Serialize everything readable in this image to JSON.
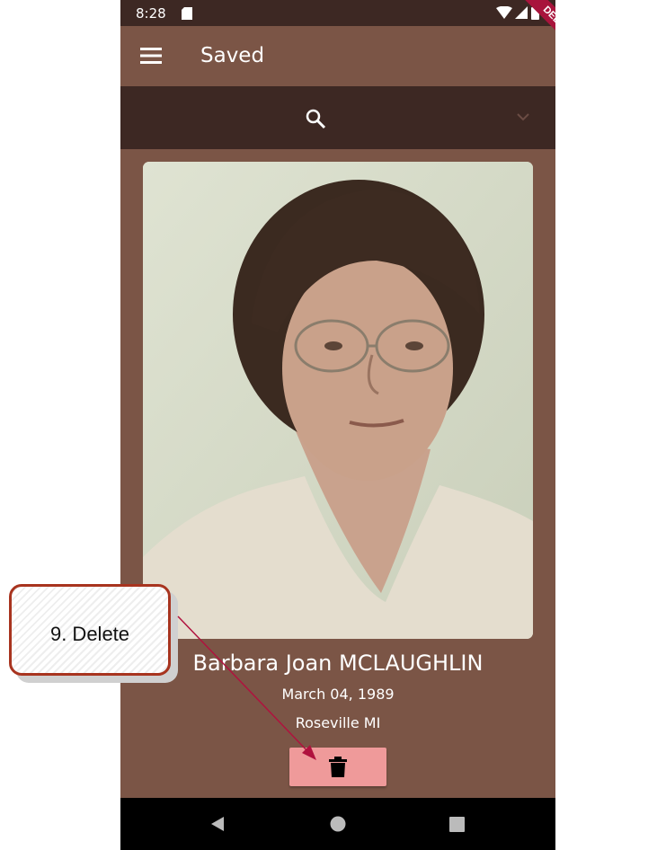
{
  "status_bar": {
    "time": "8:28",
    "icons": [
      "sd-card-icon",
      "wifi-icon",
      "signal-icon",
      "battery-icon"
    ]
  },
  "app_bar": {
    "title": "Saved",
    "menu_icon": "menu-icon",
    "debug_banner": "DEBUG"
  },
  "search_bar": {
    "search_icon": "search-icon",
    "dropdown_icon": "chevron-down-icon"
  },
  "record": {
    "name": "Barbara Joan MCLAUGHLIN",
    "date": "March 04, 1989",
    "location": "Roseville MI",
    "delete_icon": "trash-icon"
  },
  "nav_bar": {
    "icons": [
      "back-icon",
      "home-icon",
      "recents-icon"
    ]
  },
  "callout": {
    "text": "9. Delete"
  },
  "colors": {
    "app_bar": "#7b5546",
    "dark_bar": "#3d2823",
    "delete_button": "#ef9a9a",
    "callout_border": "#a8341f",
    "debug_banner": "#a8143c"
  }
}
